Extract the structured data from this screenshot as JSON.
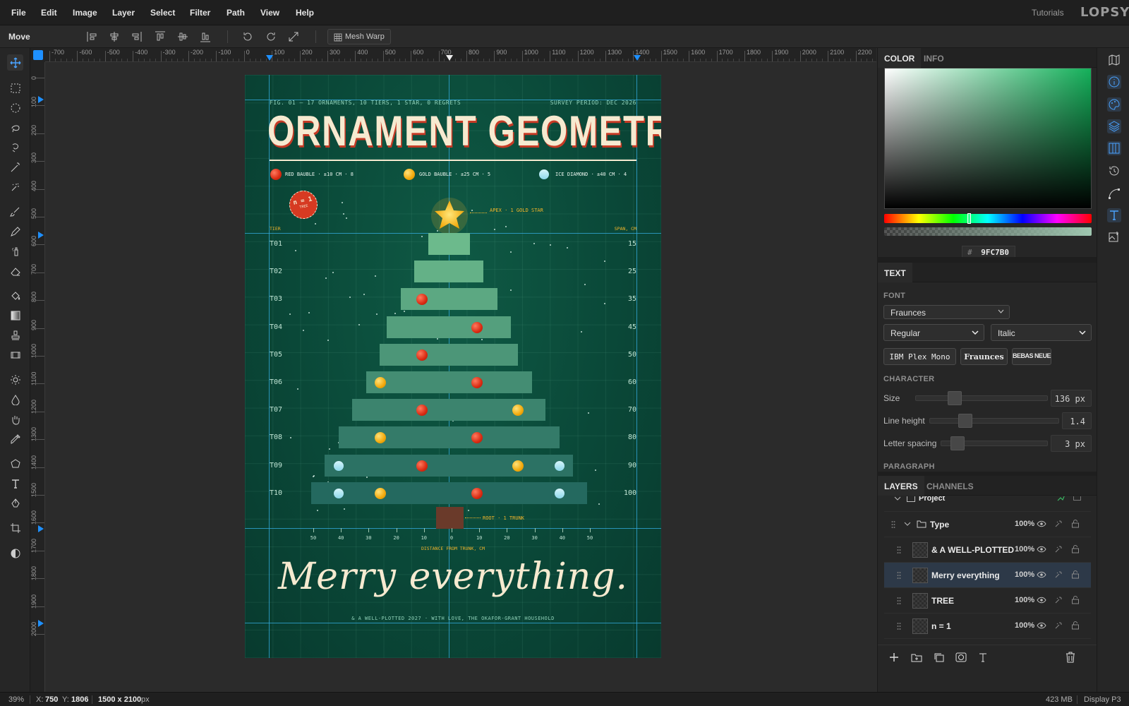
{
  "menubar": {
    "items": [
      "File",
      "Edit",
      "Image",
      "Layer",
      "Select",
      "Filter",
      "Path",
      "View",
      "Help"
    ],
    "tutorials": "Tutorials",
    "brand": "LOPSY"
  },
  "options": {
    "tool_name": "Move",
    "mesh_warp": "Mesh Warp"
  },
  "ruler": {
    "top_labels": [
      "-700",
      "-600",
      "-500",
      "-400",
      "-300",
      "-200",
      "-100",
      "0",
      "100",
      "200",
      "300",
      "400",
      "500",
      "600",
      "700",
      "800",
      "900",
      "1000",
      "1100",
      "1200",
      "1300",
      "1400",
      "1500",
      "1600",
      "1700",
      "1800",
      "1900",
      "2000",
      "2100",
      "2200"
    ],
    "left_labels": [
      "0",
      "100",
      "200",
      "300",
      "400",
      "500",
      "600",
      "700",
      "800",
      "900",
      "1000",
      "1100",
      "1200",
      "1300",
      "1400",
      "1500",
      "1600",
      "1700",
      "1800",
      "1900",
      "2000"
    ]
  },
  "poster": {
    "fig_caption": "FIG. 01 — 17 ORNAMENTS, 10 TIERS, 1 STAR, 0 REGRETS",
    "survey": "SURVEY PERIOD: DEC 2026",
    "title": "ORNAMENT GEOMETRY",
    "legend": [
      {
        "label": "RED BAUBLE · ±10 CM · 8",
        "kind": "red"
      },
      {
        "label": "GOLD BAUBLE · ±25 CM · 5",
        "kind": "gold"
      },
      {
        "label": "ICE DIAMOND · ±40 CM · 4",
        "kind": "ice"
      }
    ],
    "stamp_line1": "n = 1",
    "stamp_line2": "TREE",
    "apex_label": "APEX · 1 GOLD STAR",
    "tier_header": "TIER",
    "span_header": "SPAN, CM",
    "tiers": [
      {
        "label": "T01",
        "span": "15"
      },
      {
        "label": "T02",
        "span": "25"
      },
      {
        "label": "T03",
        "span": "35"
      },
      {
        "label": "T04",
        "span": "45"
      },
      {
        "label": "T05",
        "span": "50"
      },
      {
        "label": "T06",
        "span": "60"
      },
      {
        "label": "T07",
        "span": "70"
      },
      {
        "label": "T08",
        "span": "80"
      },
      {
        "label": "T09",
        "span": "90"
      },
      {
        "label": "T10",
        "span": "100"
      }
    ],
    "root_label": "ROOT · 1 TRUNK",
    "axis_ticks": [
      "50",
      "40",
      "30",
      "20",
      "10",
      "0",
      "10",
      "20",
      "30",
      "40",
      "50"
    ],
    "axis_title": "DISTANCE FROM TRUNK, CM",
    "greeting": "Merry everything.",
    "footer": "& A WELL-PLOTTED 2027 · WITH LOVE, THE OKAFOR-GRANT HOUSEHOLD",
    "colors": {
      "bg": "#0a4838",
      "title": "#f6ead0",
      "title_shadow": "#c63a25",
      "accent": "#f2b52a"
    }
  },
  "color_panel": {
    "tabs": [
      "COLOR",
      "INFO"
    ],
    "hex_label": "#",
    "hex_value": "9FC7B0"
  },
  "text_panel": {
    "tab": "TEXT",
    "font_label": "FONT",
    "font_value": "Fraunces",
    "weight_value": "Regular",
    "style_value": "Italic",
    "font_chips": [
      "IBM Plex Mono",
      "Fraunces",
      "BEBAS NEUE"
    ],
    "character_label": "CHARACTER",
    "size_label": "Size",
    "size_value": "136 px",
    "line_height_label": "Line height",
    "line_height_value": "1.4",
    "letter_spacing_label": "Letter spacing",
    "letter_spacing_value": "3 px",
    "paragraph_label": "PARAGRAPH"
  },
  "layers_panel": {
    "tabs": [
      "LAYERS",
      "CHANNELS"
    ],
    "project": "Project",
    "rows": [
      {
        "name": "Type",
        "opacity": "100%",
        "kind": "folder"
      },
      {
        "name": "& A WELL-PLOTTED",
        "opacity": "100%",
        "kind": "layer"
      },
      {
        "name": "Merry everything",
        "opacity": "100%",
        "kind": "layer",
        "selected": true
      },
      {
        "name": "TREE",
        "opacity": "100%",
        "kind": "layer"
      },
      {
        "name": "n = 1",
        "opacity": "100%",
        "kind": "layer"
      },
      {
        "name": "ROOT · 1 TRUNK",
        "opacity": "100%",
        "kind": "layer"
      }
    ]
  },
  "status": {
    "zoom": "39%",
    "x_label": "X:",
    "x_value": "750",
    "y_label": "Y:",
    "y_value": "1806",
    "doc_size": "1500 x 2100",
    "doc_unit": "px",
    "memory": "423 MB",
    "profile": "Display P3"
  }
}
